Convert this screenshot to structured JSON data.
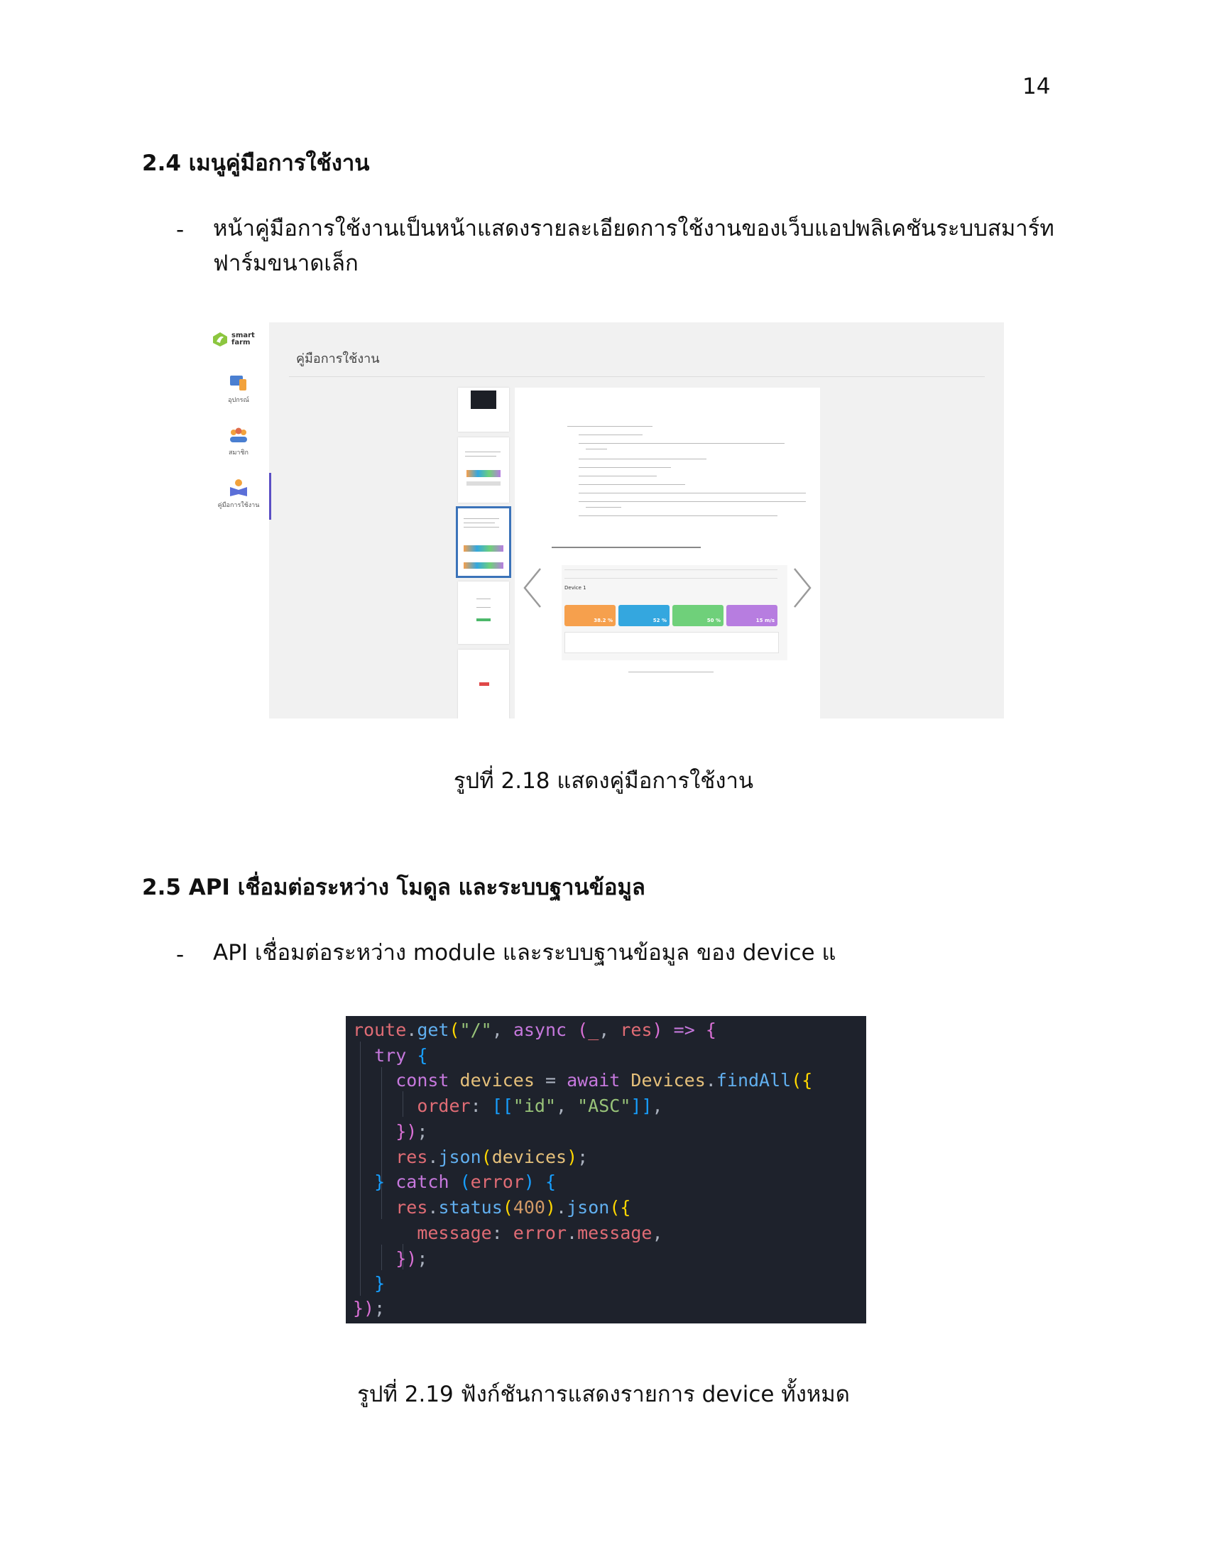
{
  "page_number": "14",
  "section_2_4": {
    "heading": "2.4 เมนูคู่มือการใช้งาน",
    "bullet_dash": "-",
    "bullet_line1": "หน้าคู่มือการใช้งานเป็นหน้าแสดงรายละเอียดการใช้งานของเว็บแอปพลิเคชันระบบสมาร์ท",
    "bullet_line2": "ฟาร์มขนาดเล็ก"
  },
  "figure_2_18": {
    "app": {
      "logo_text_1": "smart",
      "logo_text_2": "farm",
      "nav": [
        {
          "label": "อุปกรณ์",
          "icon": "device-icon"
        },
        {
          "label": "สมาชิก",
          "icon": "members-icon"
        },
        {
          "label": "คู่มือการใช้งาน",
          "icon": "manual-icon"
        }
      ],
      "page_title": "คู่มือการใช้งาน",
      "preview": {
        "device_title": "Device 1",
        "cards": [
          {
            "value": "38.2 %",
            "color": "#f6a04d"
          },
          {
            "value": "52 %",
            "color": "#34a7df"
          },
          {
            "value": "50 %",
            "color": "#6fd07a"
          },
          {
            "value": "15 m/s",
            "color": "#b77de0"
          }
        ]
      }
    },
    "caption": "รูปที่ 2.18  แสดงคู่มือการใช้งาน"
  },
  "section_2_5": {
    "heading": "2.5 API เชื่อมต่อระหว่าง โมดูล และระบบฐานข้อมูล",
    "bullet_dash": "-",
    "bullet_line1": "API เชื่อมต่อระหว่าง module และระบบฐานข้อมูล ของ device แ"
  },
  "figure_2_19": {
    "code_lines": [
      "route.get(\"/\", async (_, res) => {",
      "  try {",
      "    const devices = await Devices.findAll({",
      "      order: [[\"id\", \"ASC\"]],",
      "    });",
      "    res.json(devices);",
      "  } catch (error) {",
      "    res.status(400).json({",
      "      message: error.message,",
      "    });",
      "  }",
      "});"
    ],
    "caption": "รูปที่ 2.19 ฟังก์ชันการแสดงรายการ device ทั้งหมด"
  }
}
